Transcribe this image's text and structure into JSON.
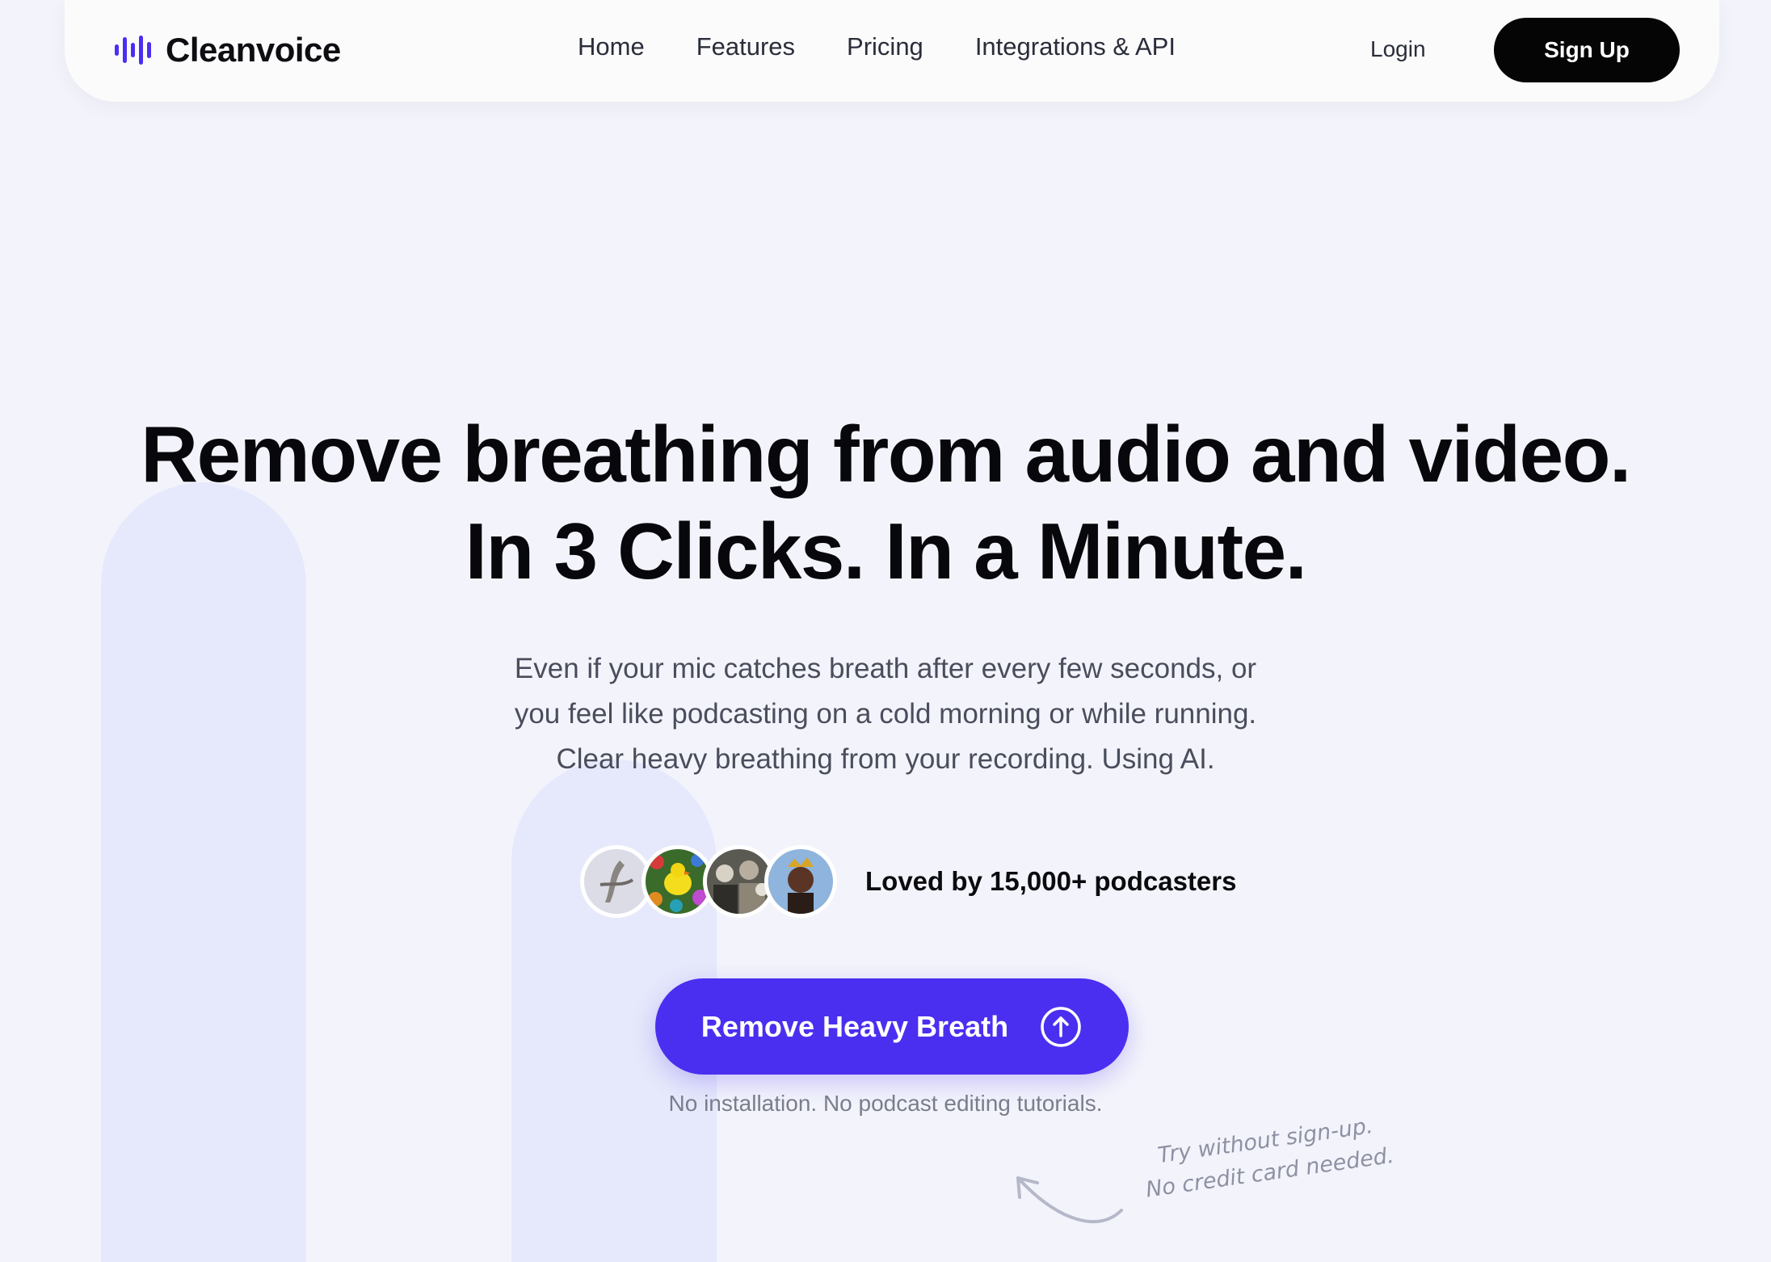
{
  "nav": {
    "logo_text": "Cleanvoice",
    "links": [
      "Home",
      "Features",
      "Pricing",
      "Integrations & API"
    ],
    "login": "Login",
    "signup": "Sign Up"
  },
  "hero": {
    "headline_line1": "Remove breathing from audio and video.",
    "headline_line2": "In 3 Clicks. In a Minute.",
    "sub_line1": "Even if your mic catches breath after every few seconds, or",
    "sub_line2": "you feel like podcasting on a cold morning or while running.",
    "sub_line3": "Clear heavy breathing from your recording. Using AI."
  },
  "social_proof": {
    "text": "Loved by 15,000+ podcasters",
    "avatars": [
      "avatar-bird",
      "avatar-toy",
      "avatar-crowd",
      "avatar-person"
    ]
  },
  "cta": {
    "label": "Remove Heavy Breath",
    "icon": "upload-arrow-icon",
    "note": "No installation. No podcast editing tutorials."
  },
  "scribble": {
    "line1": "Try without sign-up.",
    "line2": "No credit card needed."
  },
  "colors": {
    "brand": "#4a2ff0",
    "background": "#f3f4fb",
    "signup_bg": "#050505"
  }
}
